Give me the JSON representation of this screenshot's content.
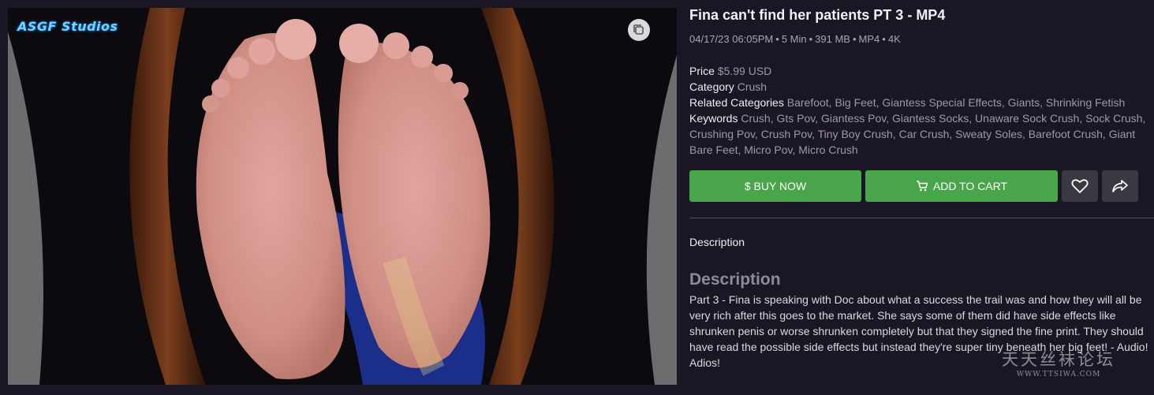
{
  "media": {
    "studio_logo": "ASGF Studios"
  },
  "product": {
    "title": "Fina can't find her patients PT 3 - MP4",
    "meta": [
      "04/17/23 06:05PM",
      "5 Min",
      "391 MB",
      "MP4",
      "4K"
    ],
    "price_label": "Price",
    "price_value": "$5.99 USD",
    "category_label": "Category",
    "category_value": "Crush",
    "related_label": "Related Categories",
    "related_value": "Barefoot, Big Feet, Giantess Special Effects, Giants, Shrinking Fetish",
    "keywords_label": "Keywords",
    "keywords_value": "Crush, Gts Pov, Giantess Pov, Giantess Socks, Unaware Sock Crush, Sock Crush, Crushing Pov, Crush Pov, Tiny Boy Crush, Car Crush, Sweaty Soles, Barefoot Crush, Giant Bare Feet, Micro Pov, Micro Crush"
  },
  "actions": {
    "buy_label": "$ BUY NOW",
    "cart_label": "ADD TO CART"
  },
  "description": {
    "tab_label": "Description",
    "heading": "Description",
    "body": "Part 3 - Fina is speaking with Doc about what a success the trail was and how they will all be very rich after this goes to the market. She says some of them did have side effects like shrunken penis or worse shrunken completely but that they signed the fine print. They should have read the possible side effects but instead they're super tiny beneath her big feet! - Audio! Adios!"
  },
  "watermark": {
    "main": "天天丝袜论坛",
    "sub": "WWW.TTSIWA.COM"
  },
  "colors": {
    "background": "#1a1624",
    "accent_green": "#49a54a",
    "icon_button": "#3a3841"
  }
}
